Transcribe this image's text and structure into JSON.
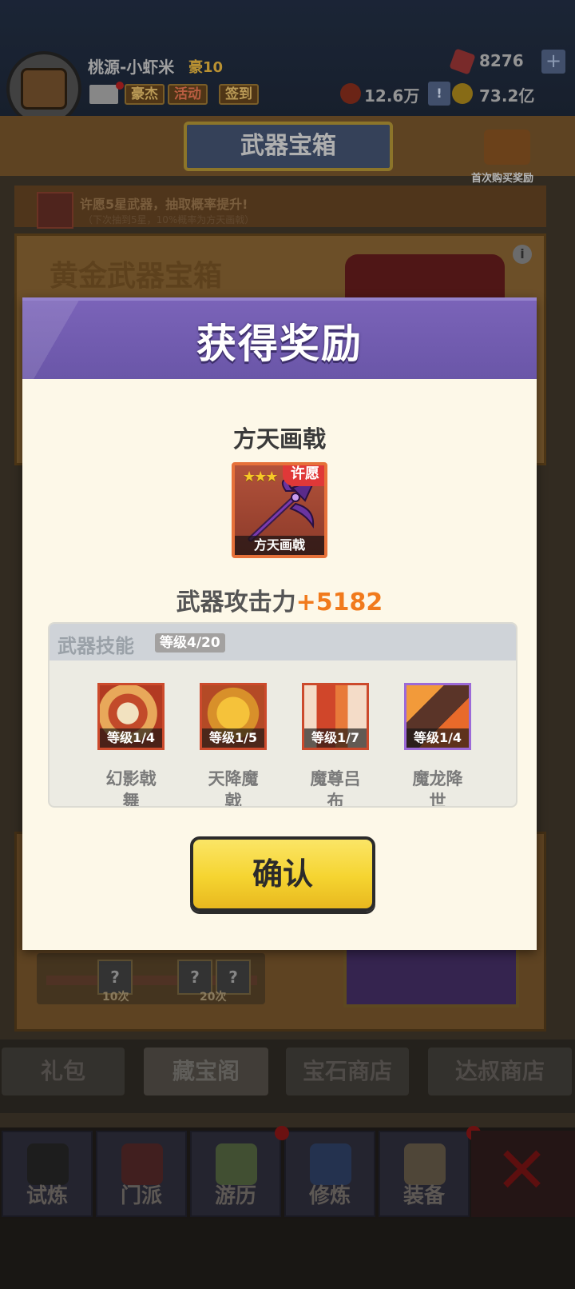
{
  "player": {
    "name": "桃源-小虾米",
    "rank": "豪10",
    "buttons": [
      "豪杰",
      "活动",
      "签到"
    ]
  },
  "resources": {
    "gems": "8276",
    "power": "12.6万",
    "gold": "73.2亿"
  },
  "screen": {
    "title": "武器宝箱",
    "first_buy_reward": "首次购买奖励",
    "notice": "许愿5星武器，抽取概率提升!",
    "notice_sub": "（下次抽到5星，10%概率为方天画戟）",
    "chest_title": "黄金武器宝箱",
    "progress_labels": [
      "10次",
      "20次"
    ]
  },
  "shop_tabs": [
    "礼包",
    "藏宝阁",
    "宝石商店",
    "达叔商店"
  ],
  "bottom_nav": [
    "试炼",
    "门派",
    "游历",
    "修炼",
    "装备"
  ],
  "modal": {
    "title": "获得奖励",
    "item_name": "方天画戟",
    "weapon": {
      "stars": 3,
      "badge": "许愿",
      "caption": "方天画戟"
    },
    "attack_label": "武器攻击力",
    "attack_value": "+5182",
    "skills_header": "武器技能",
    "skills_level": "等级4/20",
    "skills": [
      {
        "level": "等级1/4",
        "name": "幻影戟舞",
        "frame": "red"
      },
      {
        "level": "等级1/5",
        "name": "天降魔戟",
        "frame": "red"
      },
      {
        "level": "等级1/7",
        "name": "魔尊吕布",
        "frame": "red"
      },
      {
        "level": "等级1/4",
        "name": "魔龙降世",
        "frame": "purple"
      }
    ],
    "confirm_label": "确认"
  },
  "colors": {
    "header_purple": "#6a56a8",
    "attack_orange": "#f17a1c",
    "confirm_yellow": "#f5d430"
  }
}
